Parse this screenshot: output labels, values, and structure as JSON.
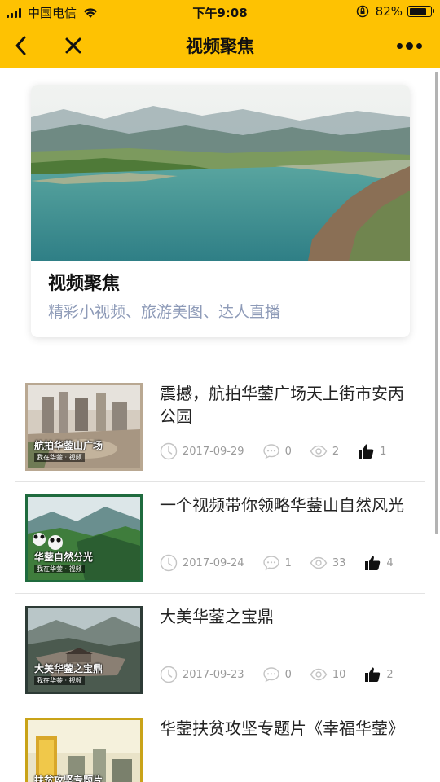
{
  "status_bar": {
    "carrier": "中国电信",
    "time": "下午9:08",
    "battery": "82%",
    "battery_level": 0.82
  },
  "nav": {
    "title": "视频聚焦",
    "back_icon": "back-arrow-icon",
    "close_icon": "close-icon",
    "more_icon": "more-dots-icon"
  },
  "banner": {
    "title": "视频聚焦",
    "subtitle": "精彩小视频、旅游美图、达人直播"
  },
  "colors": {
    "accent": "#fec202",
    "subtitle": "#8e9bb8",
    "meta": "#9a9a9a"
  },
  "items": [
    {
      "title": "震撼，航拍华蓥广场天上街市安丙公园",
      "thumb_label": "航拍华蓥山广场",
      "thumb_sub": "我在华蓥 · 视频",
      "date": "2017-09-29",
      "comments": "0",
      "views": "2",
      "likes": "1"
    },
    {
      "title": "一个视频带你领略华蓥山自然风光",
      "thumb_label": "华蓥自然分光",
      "thumb_sub": "我在华蓥 · 视频",
      "date": "2017-09-24",
      "comments": "1",
      "views": "33",
      "likes": "4"
    },
    {
      "title": "大美华蓥之宝鼎",
      "thumb_label": "大美华蓥之宝鼎",
      "thumb_sub": "我在华蓥 · 视频",
      "date": "2017-09-23",
      "comments": "0",
      "views": "10",
      "likes": "2"
    },
    {
      "title": "华蓥扶贫攻坚专题片《幸福华蓥》",
      "thumb_label": "扶贫攻坚专题片",
      "thumb_sub": "",
      "date": "",
      "comments": "",
      "views": "",
      "likes": ""
    }
  ]
}
